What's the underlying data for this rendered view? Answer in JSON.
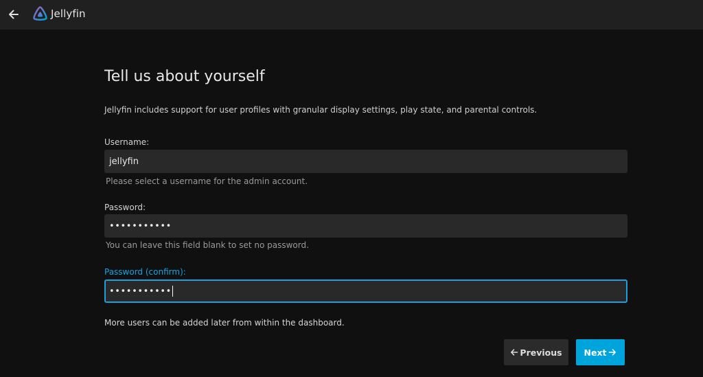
{
  "header": {
    "back_icon": "arrow-left-icon",
    "logo_icon": "jellyfin-logo-icon",
    "brand": "Jellyfin"
  },
  "wizard": {
    "title": "Tell us about yourself",
    "intro": "Jellyfin includes support for user profiles with granular display settings, play state, and parental controls.",
    "username": {
      "label": "Username:",
      "value": "jellyfin",
      "help": "Please select a username for the admin account."
    },
    "password": {
      "label": "Password:",
      "value": "•••••••••••",
      "help": "You can leave this field blank to set no password."
    },
    "password_confirm": {
      "label": "Password (confirm):",
      "value": "•••••••••••",
      "focused": true
    },
    "footer_note": "More users can be added later from within the dashboard.",
    "previous_label": "Previous",
    "next_label": "Next"
  },
  "colors": {
    "accent": "#00a4dc",
    "focus_label": "#18a3e4",
    "background": "#101010",
    "header": "#202020",
    "input": "#292929"
  }
}
